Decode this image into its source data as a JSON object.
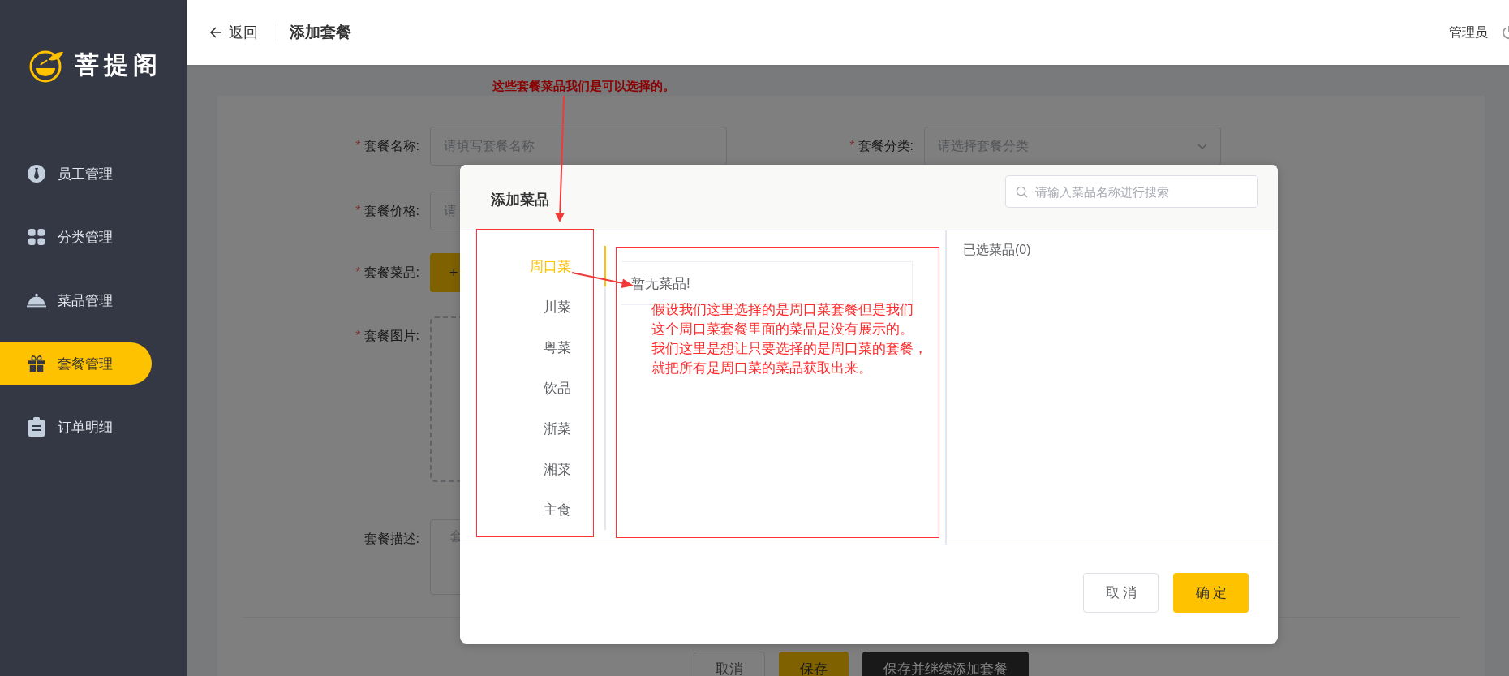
{
  "sidebar": {
    "logo": "菩提阁",
    "items": [
      {
        "label": "员工管理",
        "selected": false
      },
      {
        "label": "分类管理",
        "selected": false
      },
      {
        "label": "菜品管理",
        "selected": false
      },
      {
        "label": "套餐管理",
        "selected": true
      },
      {
        "label": "订单明细",
        "selected": false
      }
    ]
  },
  "header": {
    "back": "返回",
    "title": "添加套餐",
    "user": "管理员"
  },
  "form": {
    "rows": [
      {
        "fields": [
          {
            "kind": "input",
            "mark": "*",
            "label": "套餐名称:",
            "placeholder": "请填写套餐名称"
          },
          {
            "kind": "select",
            "mark": "*",
            "label": "套餐分类:",
            "placeholder": "请选择套餐分类"
          }
        ]
      },
      {
        "fields": [
          {
            "kind": "input",
            "mark": "*",
            "label": "套餐价格:",
            "placeholder": "请"
          }
        ]
      },
      {
        "fields": [
          {
            "kind": "button",
            "mark": "*",
            "label": "套餐菜品:",
            "text": "+"
          }
        ]
      },
      {
        "fields": [
          {
            "kind": "upload",
            "mark": "*",
            "label": "套餐图片:"
          }
        ]
      },
      {
        "fields": [
          {
            "kind": "textarea",
            "label": "套餐描述:",
            "placeholder": "套"
          }
        ]
      }
    ],
    "buttons": [
      {
        "label": "取消",
        "kind": "default"
      },
      {
        "label": "保存",
        "kind": "primary"
      },
      {
        "label": "保存并继续添加套餐",
        "kind": "dark"
      }
    ]
  },
  "dialog": {
    "title": "添加菜品",
    "search_placeholder": "请输入菜品名称进行搜索",
    "categories": [
      {
        "label": "周口菜",
        "selected": true
      },
      {
        "label": "川菜",
        "selected": false
      },
      {
        "label": "粤菜",
        "selected": false
      },
      {
        "label": "饮品",
        "selected": false
      },
      {
        "label": "浙菜",
        "selected": false
      },
      {
        "label": "湘菜",
        "selected": false
      },
      {
        "label": "主食",
        "selected": false
      }
    ],
    "empty_text": "暂无菜品!",
    "selected_title": "已选菜品(0)",
    "buttons": [
      {
        "label": "取消",
        "kind": "default"
      },
      {
        "label": "确定",
        "kind": "primary"
      }
    ]
  },
  "annotations": {
    "top_note": "这些套餐菜品我们是可以选择的。",
    "list_note": [
      "假设我们这里选择的是周口菜套餐但是我们",
      "这个周口菜套餐里面的菜品是没有展示的。",
      "我们这里是想让只要选择的是周口菜的套餐，",
      "就把所有是周口菜的菜品获取出来。"
    ]
  }
}
